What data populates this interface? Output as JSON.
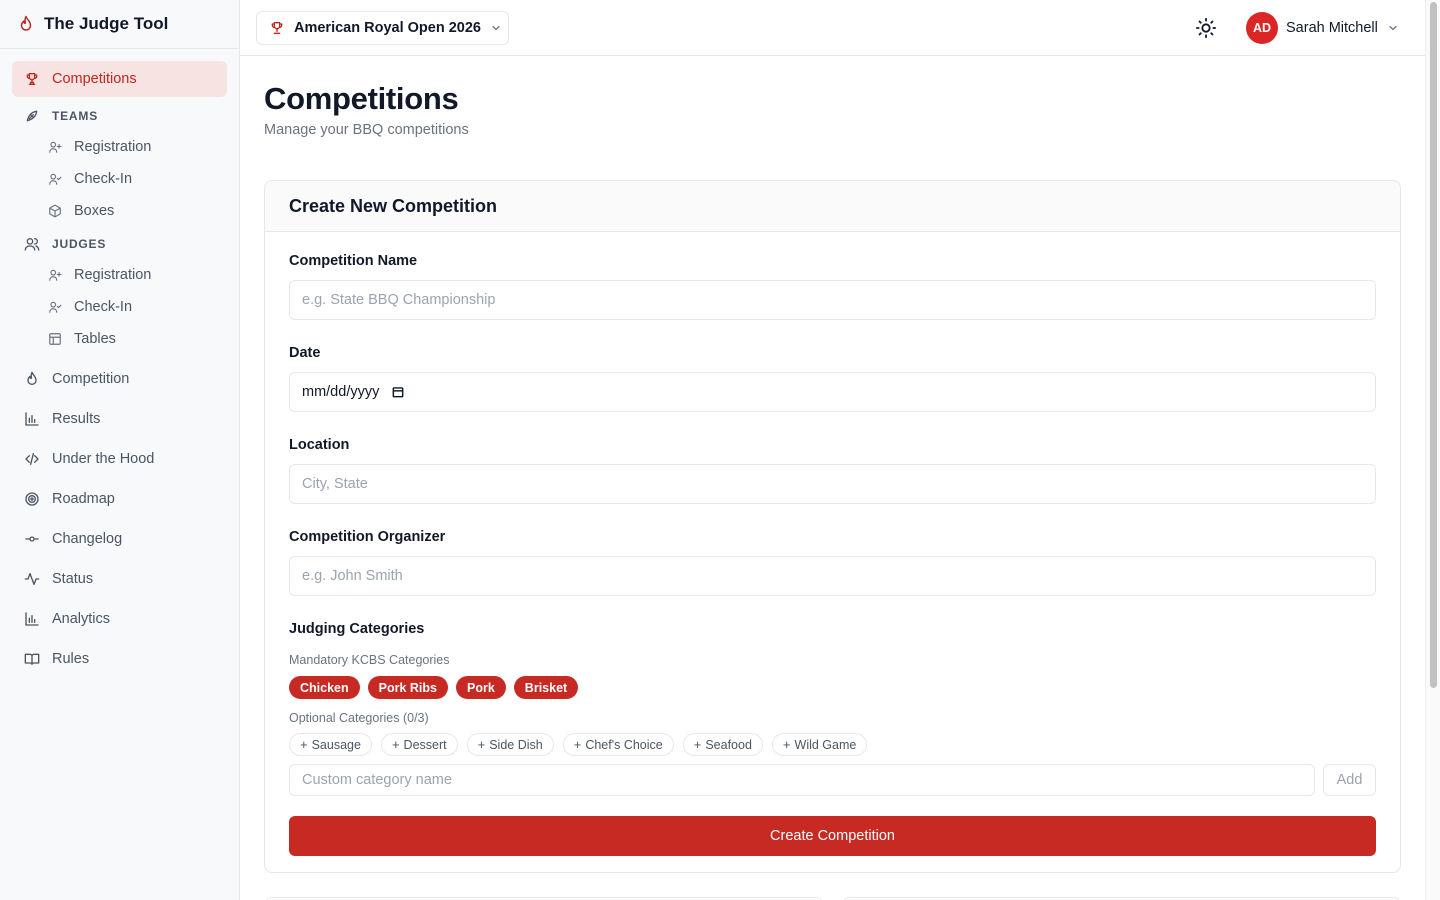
{
  "app": {
    "name": "The Judge Tool"
  },
  "sidebar": {
    "competitions": "Competitions",
    "teams": {
      "section": "TEAMS",
      "items": [
        "Registration",
        "Check-In",
        "Boxes"
      ]
    },
    "judges": {
      "section": "JUDGES",
      "items": [
        "Registration",
        "Check-In",
        "Tables"
      ]
    },
    "items": [
      "Competition",
      "Results",
      "Under the Hood",
      "Roadmap",
      "Changelog",
      "Status",
      "Analytics",
      "Rules"
    ]
  },
  "header": {
    "competition_select": "American Royal Open 2026",
    "user": {
      "initials": "AD",
      "name": "Sarah Mitchell"
    }
  },
  "page": {
    "title": "Competitions",
    "subtitle": "Manage your BBQ competitions"
  },
  "form": {
    "title": "Create New Competition",
    "name_label": "Competition Name",
    "name_placeholder": "e.g. State BBQ Championship",
    "date_label": "Date",
    "date_value": "mm/dd/yyyy",
    "location_label": "Location",
    "location_placeholder": "City, State",
    "organizer_label": "Competition Organizer",
    "organizer_placeholder": "e.g. John Smith",
    "categories_label": "Judging Categories",
    "mandatory_label": "Mandatory KCBS Categories",
    "mandatory": [
      "Chicken",
      "Pork Ribs",
      "Pork",
      "Brisket"
    ],
    "optional_label": "Optional Categories (0/3)",
    "optional": [
      "Sausage",
      "Dessert",
      "Side Dish",
      "Chef's Choice",
      "Seafood",
      "Wild Game"
    ],
    "custom_placeholder": "Custom category name",
    "add_label": "Add",
    "submit_label": "Create Competition"
  },
  "colors": {
    "accent": "#c62a22",
    "active_bg": "#f8e3e3",
    "avatar": "#dc2626"
  }
}
